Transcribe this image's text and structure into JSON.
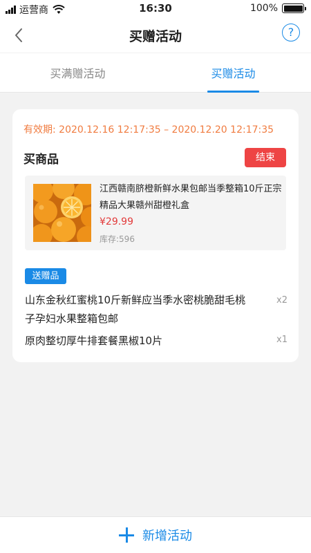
{
  "status_bar": {
    "carrier": "运营商",
    "time": "16:30",
    "battery": "100%",
    "battery_level": 1.0
  },
  "nav": {
    "title": "买赠活动",
    "back_icon": "chevron-left-icon",
    "help_label": "?"
  },
  "tabs": [
    {
      "label": "买满赠活动",
      "active": false
    },
    {
      "label": "买赠活动",
      "active": true
    }
  ],
  "activity": {
    "validity": "有效期: 2020.12.16 12:17:35 – 2020.12.20 12:17:35",
    "buy_label": "买商品",
    "status_button": "结束",
    "product": {
      "title": "江西赣南脐橙新鲜水果包邮当季整箱10斤正宗精品大果赣州甜橙礼盒",
      "price": "¥29.99",
      "stock": "库存:596",
      "image_icon": "orange-fruit-image"
    },
    "gift_badge": "送赠品",
    "gifts": [
      {
        "name": "山东金秋红蜜桃10斤新鲜应当季水密桃脆甜毛桃子孕妇水果整箱包邮",
        "qty": "x2"
      },
      {
        "name": "原肉整切厚牛排套餐黑椒10片",
        "qty": "x1"
      }
    ]
  },
  "bottom": {
    "add_label": "新增活动",
    "add_icon": "plus-icon"
  },
  "colors": {
    "accent": "#1a8ae6",
    "danger": "#ee4444",
    "validity": "#f07b3f",
    "price": "#e23a3a"
  }
}
